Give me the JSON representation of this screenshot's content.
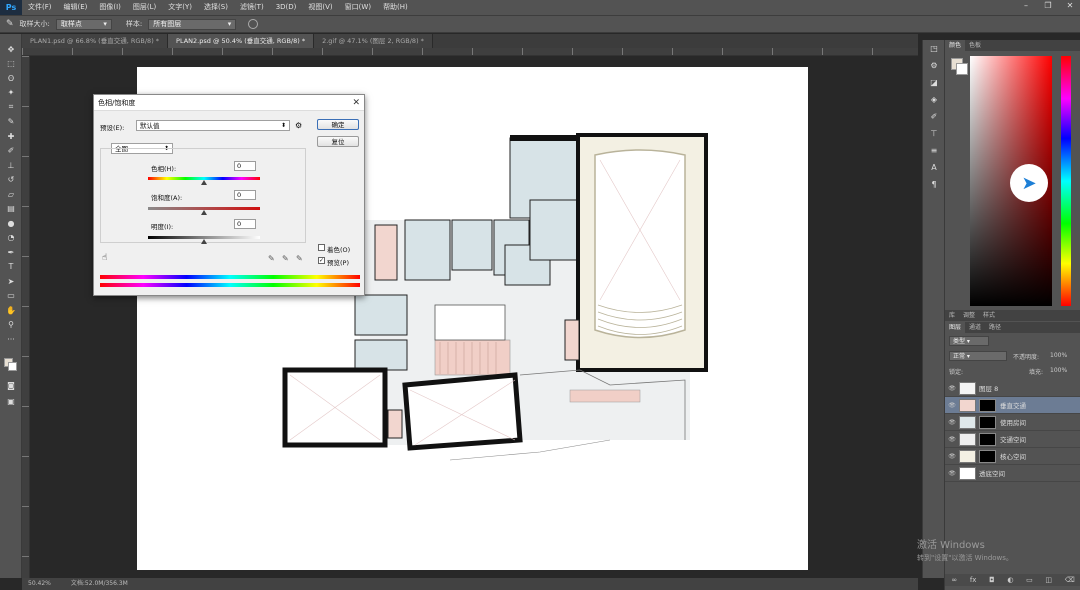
{
  "app": {
    "logo": "Ps",
    "menu": [
      "文件(F)",
      "编辑(E)",
      "图像(I)",
      "图层(L)",
      "文字(Y)",
      "选择(S)",
      "滤镜(T)",
      "3D(D)",
      "视图(V)",
      "窗口(W)",
      "帮助(H)"
    ],
    "window_controls": [
      "–",
      "❐",
      "✕"
    ]
  },
  "options_bar": {
    "sample_size_label": "取样大小:",
    "sample_size_value": "取样点",
    "sample_label": "样本:",
    "sample_value": "所有图层"
  },
  "doc_tabs": [
    {
      "label": "PLAN1.psd @ 66.8% (垂直交通, RGB/8) *",
      "active": false
    },
    {
      "label": "PLAN2.psd @ 50.4% (垂直交通, RGB/8) *",
      "active": true
    },
    {
      "label": "2.gif @ 47.1% (图层 2, RGB/8) *",
      "active": false
    }
  ],
  "dialog": {
    "title": "色相/饱和度",
    "preset_label": "预设(E):",
    "preset_value": "默认值",
    "ok": "确定",
    "reset": "复位",
    "channel": "全图",
    "hue_label": "色相(H):",
    "hue_value": "0",
    "saturation_label": "饱和度(A):",
    "saturation_value": "0",
    "lightness_label": "明度(I):",
    "lightness_value": "0",
    "colorize_label": "着色(O)",
    "preview_label": "预览(P)",
    "colorize": false,
    "preview": true
  },
  "panels": {
    "color_tabs": [
      "颜色",
      "色板"
    ],
    "adjust_tabs": [
      "库",
      "调整",
      "样式"
    ],
    "layer_tabs": [
      "图层",
      "通道",
      "路径"
    ],
    "kind_filter": "类型",
    "blend_mode": "正常",
    "opacity_label": "不透明度:",
    "opacity_value": "100%",
    "lock_label": "锁定:",
    "fill_label": "填充:",
    "fill_value": "100%",
    "layers": [
      {
        "name": "图层 8",
        "selected": false,
        "mask": false,
        "thumb": "#f4f4f4"
      },
      {
        "name": "垂直交通",
        "selected": true,
        "mask": true,
        "thumb": "#f2d6cf"
      },
      {
        "name": "使用房间",
        "selected": false,
        "mask": true,
        "thumb": "#dfe8ea"
      },
      {
        "name": "交通空间",
        "selected": false,
        "mask": true,
        "thumb": "#eeeeee"
      },
      {
        "name": "核心空间",
        "selected": false,
        "mask": true,
        "thumb": "#f3f0e3"
      },
      {
        "name": "透底空间",
        "selected": false,
        "mask": false,
        "thumb": "#ffffff"
      }
    ]
  },
  "status": {
    "zoom": "50.42%",
    "doc_size": "文档:52.0M/356.3M"
  },
  "watermark": {
    "line1": "激活 Windows",
    "line2": "转到\"设置\"以激活 Windows。"
  }
}
